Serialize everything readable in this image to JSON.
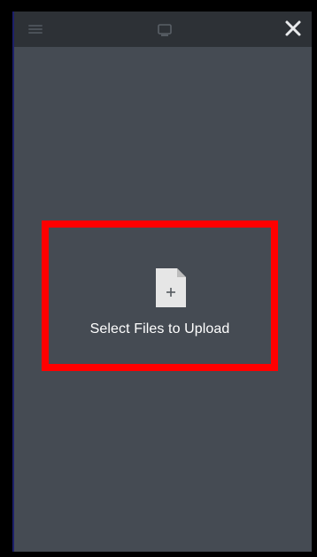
{
  "topbar": {
    "menu_icon": "hamburger-menu-icon",
    "device_icon": "monitor-icon",
    "close_icon": "close-icon"
  },
  "upload": {
    "icon": "file-add-icon",
    "label": "Select Files to Upload",
    "highlight_color": "#ff0000"
  },
  "colors": {
    "background": "#454b53",
    "topbar": "#2d3136"
  }
}
